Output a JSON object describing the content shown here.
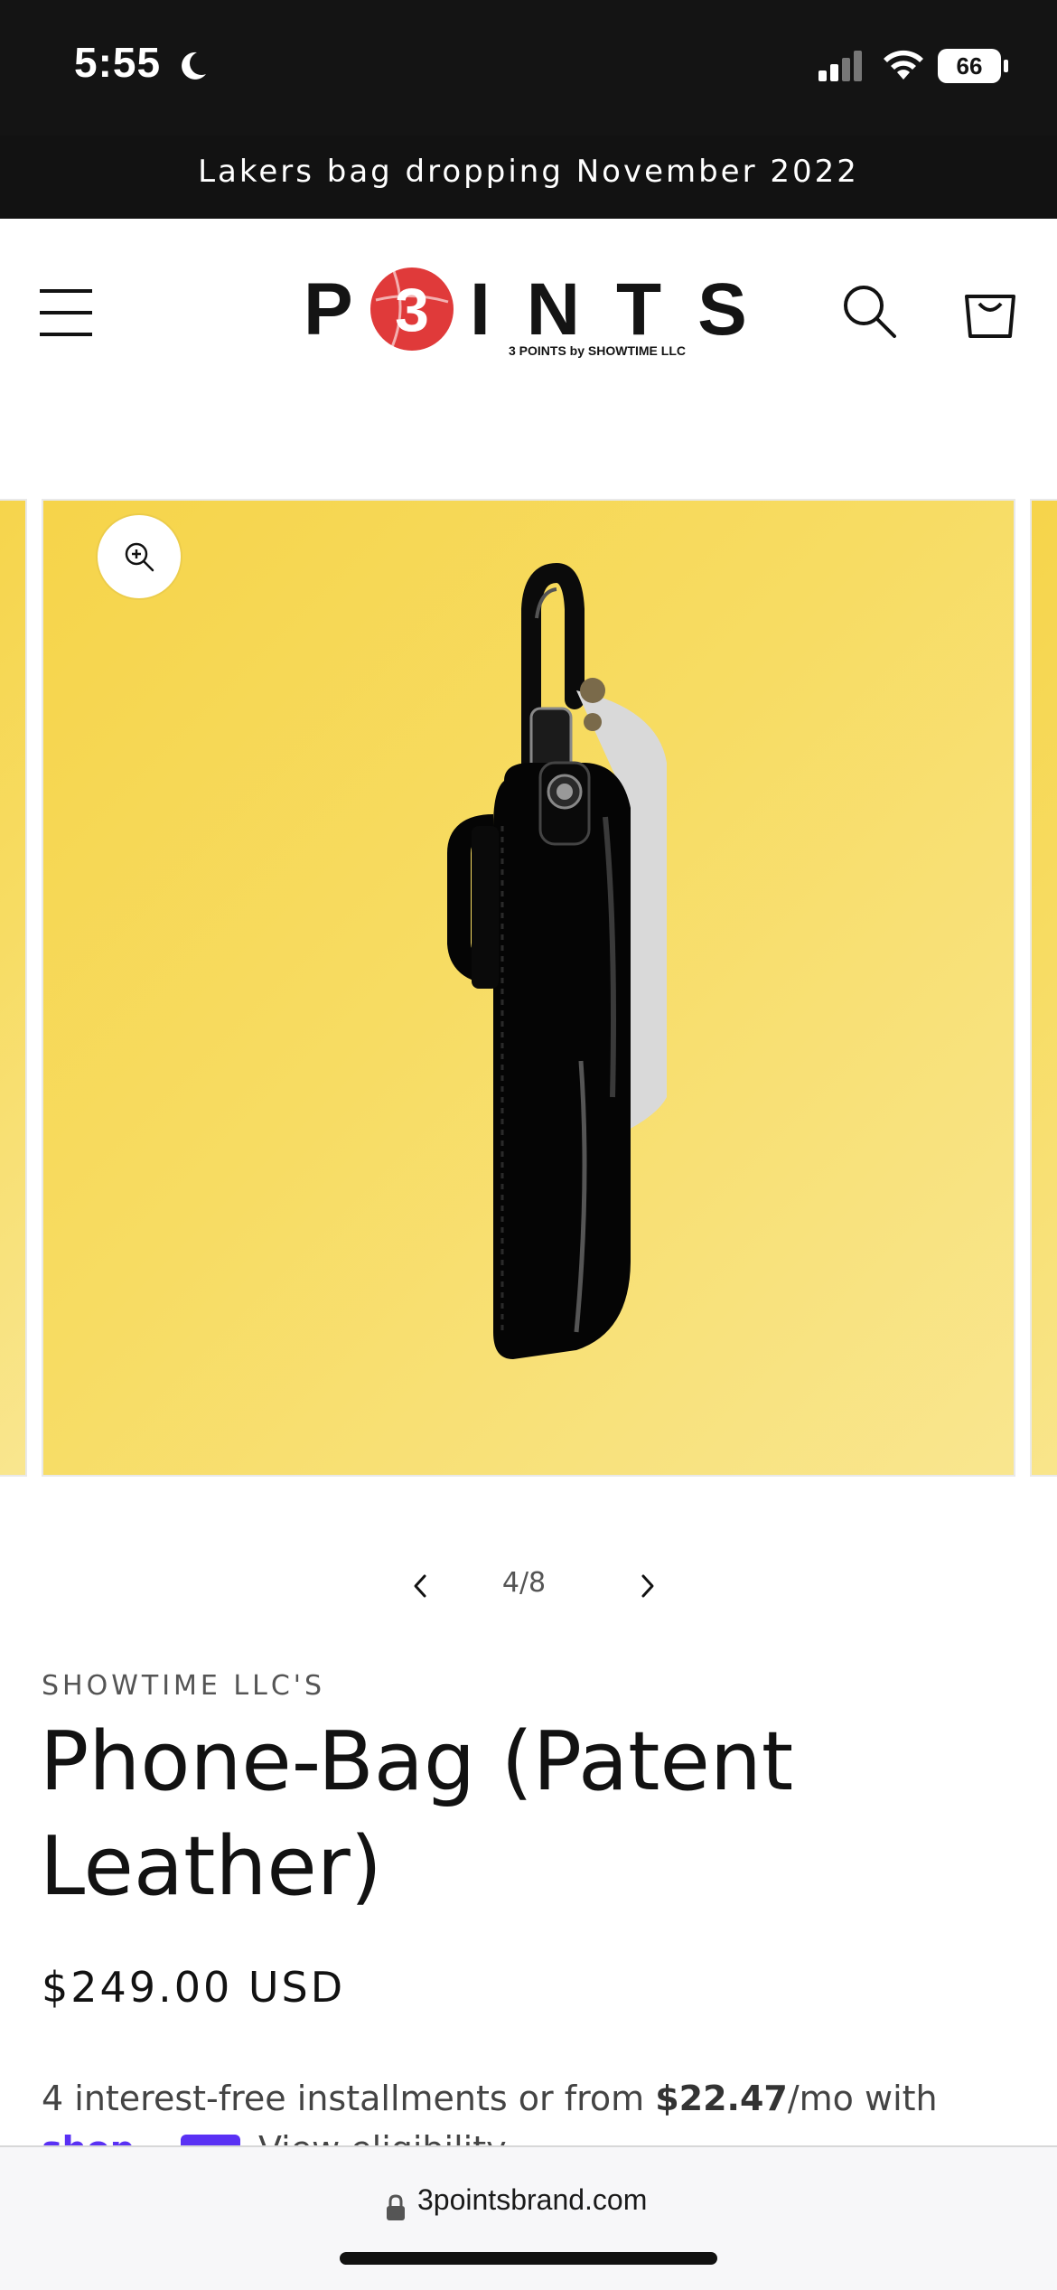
{
  "status_bar": {
    "time": "5:55",
    "battery": "66"
  },
  "announcement": {
    "text": "Lakers bag dropping November 2022"
  },
  "header": {
    "logo_text_left": "P",
    "logo_badge": "3",
    "logo_text_right": "INTS",
    "logo_subtitle": "3 POINTS by SHOWTIME LLC"
  },
  "gallery": {
    "counter": "4/8"
  },
  "product": {
    "vendor": "SHOWTIME LLC'S",
    "title": "Phone-Bag (Patent Leather)",
    "price": "$249.00 USD",
    "installments_prefix": "4 interest-free installments or from ",
    "installments_amount": "$22.47",
    "installments_suffix": "/mo with",
    "shop_pay_label": "shop",
    "view_eligibility": "View eligibility"
  },
  "browser": {
    "url": "3pointsbrand.com"
  },
  "colors": {
    "announcement_bg": "#121212",
    "logo_red": "#e03a3a",
    "image_bg": "#f6d44a",
    "shop_pay_purple": "#5a31f4"
  },
  "icons": [
    "moon-icon",
    "signal-icon",
    "wifi-icon",
    "battery-icon",
    "menu-icon",
    "search-icon",
    "cart-icon",
    "zoom-icon",
    "chevron-left-icon",
    "chevron-right-icon",
    "lock-icon"
  ]
}
